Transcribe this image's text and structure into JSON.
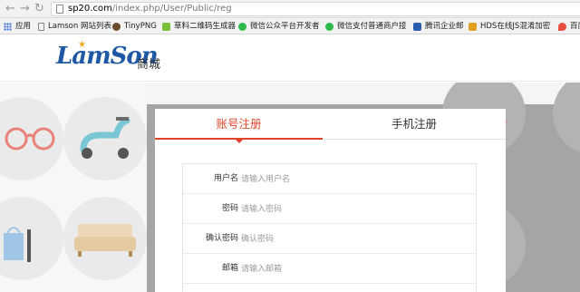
{
  "browser": {
    "url_host": "sp20.com",
    "url_path": "/index.php/User/Public/reg"
  },
  "bookmarks": [
    {
      "label": "应用",
      "color": "#3c6fd8"
    },
    {
      "label": "Lamson 网站列表",
      "color": "#aaaaaa"
    },
    {
      "label": "TinyPNG",
      "color": "#6b4a2c"
    },
    {
      "label": "草料二维码生成器",
      "color": "#7bbf3a"
    },
    {
      "label": "微信公众平台开发者",
      "color": "#2dbb4a"
    },
    {
      "label": "微信支付普通商户接",
      "color": "#2dbb4a"
    },
    {
      "label": "腾讯企业邮",
      "color": "#2a5db0"
    },
    {
      "label": "HDS在线JS混淆加密",
      "color": "#e0a020"
    },
    {
      "label": "百度",
      "color": "#e84d3d"
    }
  ],
  "header": {
    "logo_text": "LamSon",
    "logo_sub": "商城"
  },
  "tabs": {
    "account": "账号注册",
    "phone": "手机注册"
  },
  "form": {
    "username_label": "用户名",
    "username_placeholder": "请输入用户名",
    "password_label": "密码",
    "password_placeholder": "请输入密码",
    "confirm_label": "确认密码",
    "confirm_placeholder": "确认密码",
    "email_label": "邮箱",
    "email_placeholder": "请输入邮箱"
  },
  "colors": {
    "accent": "#e0452c",
    "logo_blue": "#1f58a4"
  }
}
